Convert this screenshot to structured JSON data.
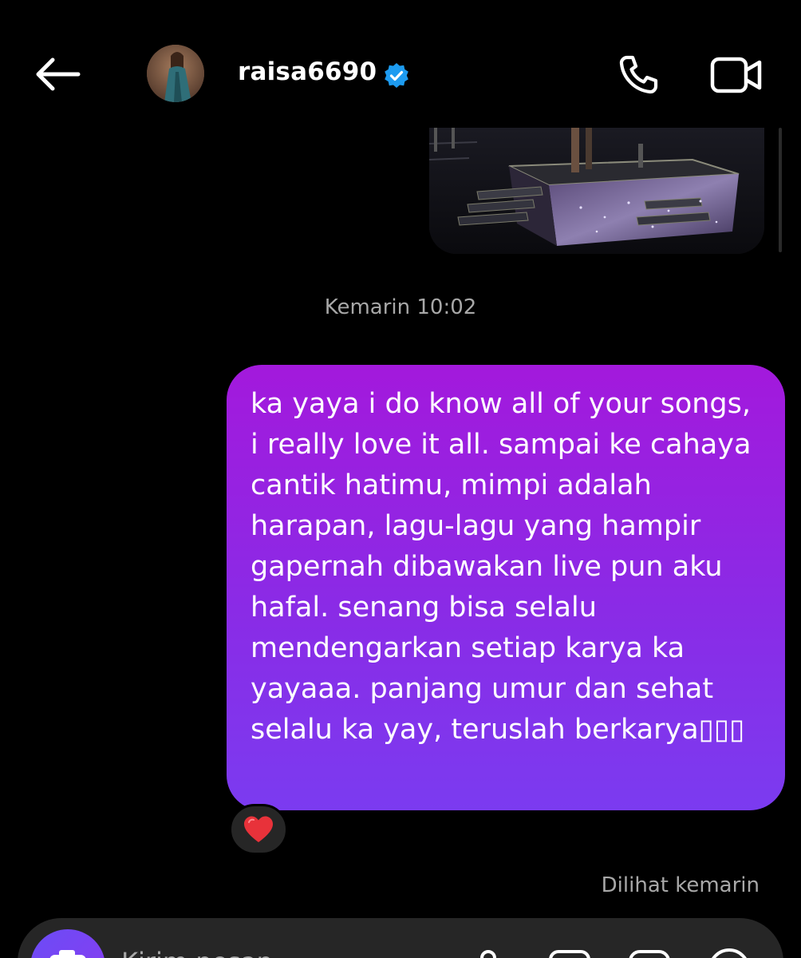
{
  "header": {
    "back_icon": "arrow-left-icon",
    "username": "raisa6690",
    "verified_icon": "verified-badge-icon",
    "call_icon": "phone-icon",
    "video_icon": "video-camera-icon"
  },
  "conversation": {
    "timestamp": "Kemarin 10:02",
    "message": {
      "text": "ka yaya i do know all of your songs, i really love it all. sampai ke cahaya cantik hatimu, mimpi adalah harapan, lagu-lagu yang hampir gapernah dibawakan live pun aku hafal. senang bisa selalu mendengarkan setiap karya ka yayaaa. panjang umur dan sehat selalu ka yay, teruslah berkarya▯▯▯",
      "reaction": "❤️"
    },
    "seen_status": "Dilihat kemarin"
  },
  "composer": {
    "placeholder": "Kirim pesan..."
  },
  "colors": {
    "background": "#000000",
    "bubble_top": "#a319dc",
    "bubble_bottom": "#7b3bf0",
    "verified_blue": "#1d9bf0",
    "muted_text": "#a8a8a8"
  }
}
